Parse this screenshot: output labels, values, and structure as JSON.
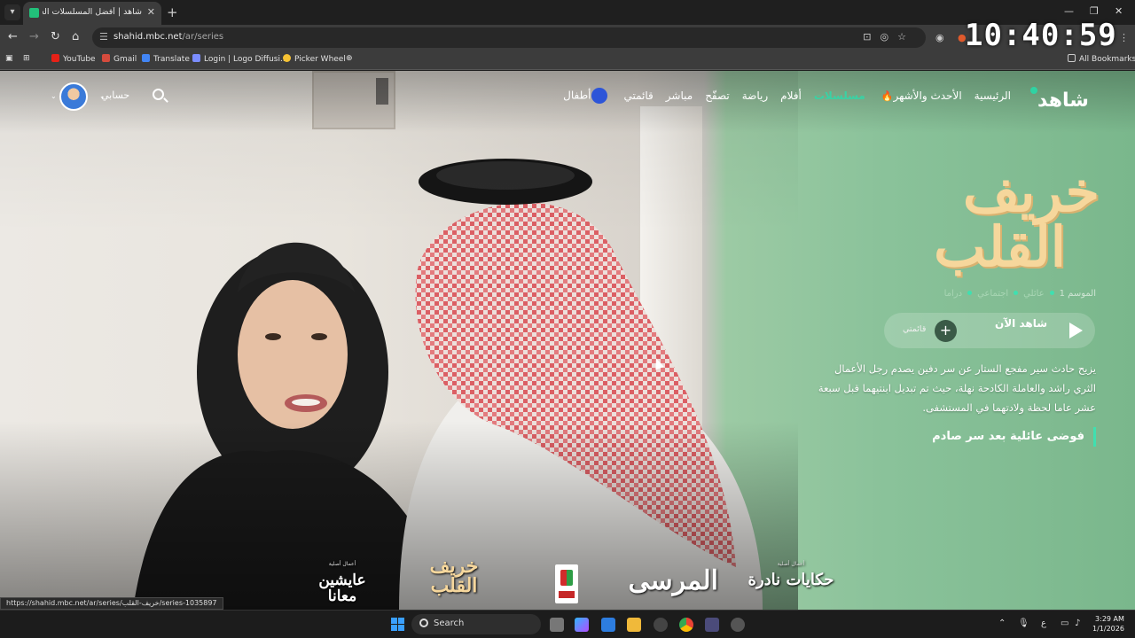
{
  "browser": {
    "tab_title": "شاهد | أفضل المسلسلات الخليجية",
    "url_host": "shahid.mbc.net",
    "url_path": "/ar/series",
    "clock": "10:40:59",
    "bookmarks": [
      "YouTube",
      "Gmail",
      "Translate",
      "Login | Logo Diffusi...",
      "Picker Wheel"
    ],
    "all_bookmarks": "All Bookmarks",
    "status_url": "https://shahid.mbc.net/ar/series/خريف-القلب/series-1035897"
  },
  "site": {
    "logo": "شاهد",
    "nav": {
      "home": "الرئيسية",
      "trending": "الأحدث والأشهر",
      "series": "مسلسلات",
      "movies": "أفلام",
      "sports": "رياضة",
      "browse": "تصفّح",
      "live": "مباشر",
      "my_list": "قائمتي",
      "kids": "أطفال"
    },
    "account": "حسابي"
  },
  "hero": {
    "show_title_line1": "خريف",
    "show_title_line2": "القلب",
    "season": "الموسم 1",
    "genres": [
      "عائلي",
      "اجتماعي",
      "دراما"
    ],
    "watch_now": "شاهد الآن",
    "my_list": "قائمتي",
    "synopsis": "يزيح حادث سير مفجع الستار عن سر دفين يصدم رجل الأعمال الثري راشد والعاملة الكادحة نهلة، حيث تم تبديل ابنتيهما قبل سبعة عشر عاما لحظة ولادتهما في المستشفى.",
    "tagline": "فوضى عائلية بعد سر صادم"
  },
  "carousel": {
    "badge": "أعمال أصلية",
    "items": [
      "عايشين معانا",
      "خريف القلب",
      "المرسى",
      "حكايات نادرة"
    ]
  },
  "taskbar": {
    "search": "Search",
    "time": "3:29 AM",
    "date": "1/1/2026",
    "lang": "ع"
  }
}
